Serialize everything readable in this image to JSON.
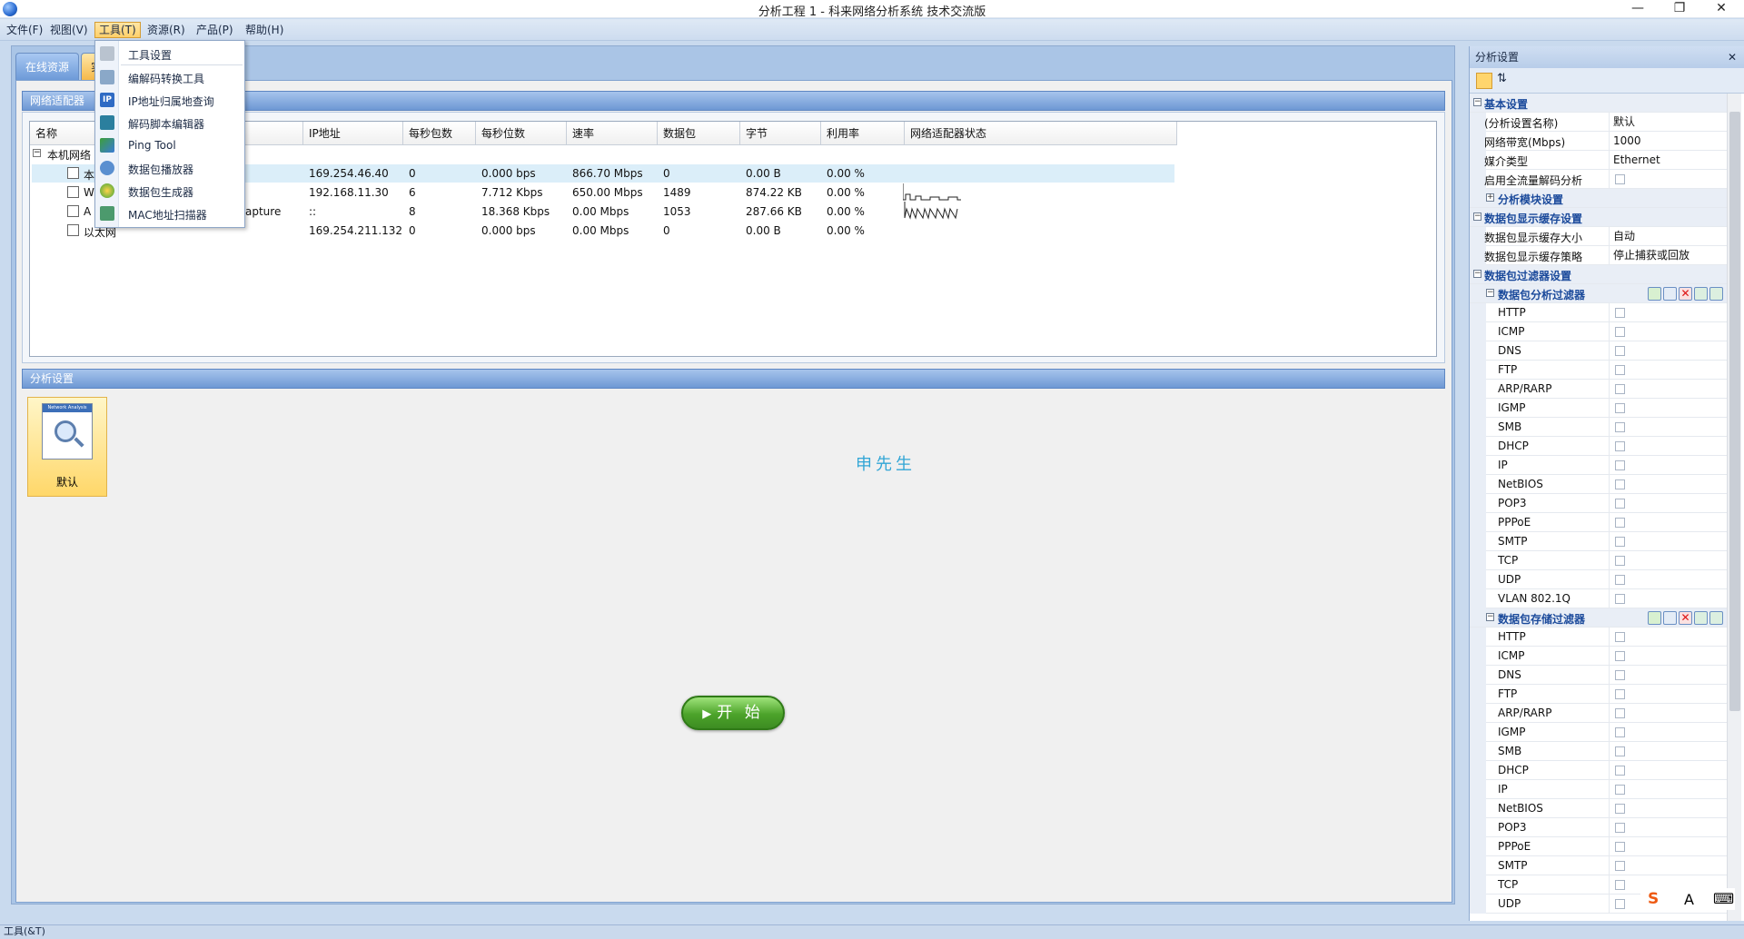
{
  "window": {
    "title": "分析工程 1 - 科来网络分析系统 技术交流版",
    "controls": [
      "—",
      "❐",
      "✕"
    ]
  },
  "menubar": [
    "文件(F)",
    "视图(V)",
    "工具(T)",
    "资源(R)",
    "产品(P)",
    "帮助(H)"
  ],
  "doc_tabs": [
    "在线资源",
    "实"
  ],
  "adapter_panel": {
    "title": "网络适配器",
    "columns": [
      "名称",
      "IP地址",
      "每秒包数",
      "每秒位数",
      "速率",
      "数据包",
      "字节",
      "利用率",
      "网络适配器状态"
    ],
    "group_label": "本机网络",
    "rows": [
      {
        "name": "本",
        "ip": "169.254.46.40",
        "pps": "0",
        "bps": "0.000 bps",
        "speed": "866.70 Mbps",
        "packets": "0",
        "bytes": "0.00 B",
        "util": "0.00 %"
      },
      {
        "name": "W",
        "ip": "192.168.11.30",
        "pps": "6",
        "bps": "7.712 Kbps",
        "speed": "650.00 Mbps",
        "packets": "1489",
        "bytes": "874.22 KB",
        "util": "0.00 %"
      },
      {
        "name": "A",
        "name_tail": "apture",
        "ip": "::",
        "pps": "8",
        "bps": "18.368 Kbps",
        "speed": "0.00 Mbps",
        "packets": "1053",
        "bytes": "287.66 KB",
        "util": "0.00 %"
      },
      {
        "name": "以太网",
        "ip": "169.254.211.132",
        "pps": "0",
        "bps": "0.000 bps",
        "speed": "0.00 Mbps",
        "packets": "0",
        "bytes": "0.00 B",
        "util": "0.00 %"
      }
    ]
  },
  "analysis_panel": {
    "title": "分析设置",
    "item_label": "默认",
    "item_icon_caption": "Network Analysis",
    "watermark": "申先生",
    "start_button": "开 始"
  },
  "tools_menu": [
    {
      "label": "工具设置",
      "icon": "tools-icon"
    },
    {
      "label": "编解码转换工具",
      "icon": "codec-icon"
    },
    {
      "label": "IP地址归属地查询",
      "icon": "ip-lookup-icon"
    },
    {
      "label": "解码脚本编辑器",
      "icon": "script-editor-icon"
    },
    {
      "label": "Ping Tool",
      "icon": "ping-icon"
    },
    {
      "label": "数据包播放器",
      "icon": "packet-player-icon"
    },
    {
      "label": "数据包生成器",
      "icon": "packet-generator-icon"
    },
    {
      "label": "MAC地址扫描器",
      "icon": "mac-scanner-icon"
    }
  ],
  "right_panel": {
    "title": "分析设置",
    "close": "✕",
    "basic": {
      "title": "基本设置",
      "rows": [
        {
          "name": "(分析设置名称)",
          "value": "默认"
        },
        {
          "name": "网络带宽(Mbps)",
          "value": "1000"
        },
        {
          "name": "媒介类型",
          "value": "Ethernet"
        },
        {
          "name": "启用全流量解码分析",
          "value": ""
        }
      ],
      "module": "分析模块设置"
    },
    "buffer": {
      "title": "数据包显示缓存设置",
      "rows": [
        {
          "name": "数据包显示缓存大小",
          "value": "自动"
        },
        {
          "name": "数据包显示缓存策略",
          "value": "停止捕获或回放"
        }
      ]
    },
    "filters": {
      "title": "数据包过滤器设置",
      "analysis_title": "数据包分析过滤器",
      "analysis_items": [
        "HTTP",
        "ICMP",
        "DNS",
        "FTP",
        "ARP/RARP",
        "IGMP",
        "SMB",
        "DHCP",
        "IP",
        "NetBIOS",
        "POP3",
        "PPPoE",
        "SMTP",
        "TCP",
        "UDP",
        "VLAN 802.1Q"
      ],
      "storage_title": "数据包存储过滤器",
      "storage_items": [
        "HTTP",
        "ICMP",
        "DNS",
        "FTP",
        "ARP/RARP",
        "IGMP",
        "SMB",
        "DHCP",
        "IP",
        "NetBIOS",
        "POP3",
        "PPPoE",
        "SMTP",
        "TCP",
        "UDP"
      ]
    }
  },
  "statusbar": "工具(&T)",
  "ime": {
    "logo": "S",
    "mode": "A",
    "keyboard": "⌨"
  }
}
